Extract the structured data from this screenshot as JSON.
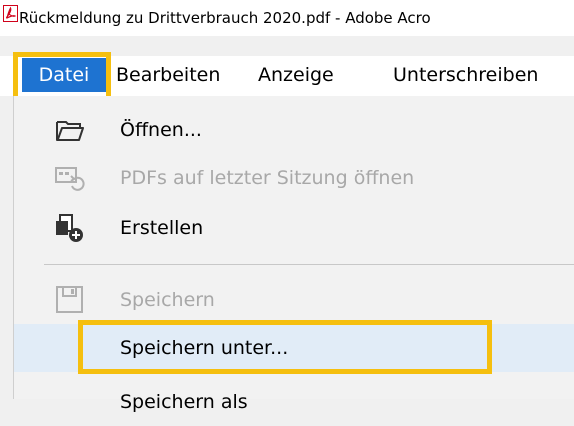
{
  "window": {
    "title": "Rückmeldung zu Drittverbrauch 2020.pdf - Adobe Acro",
    "app_icon": "pdf-icon"
  },
  "menubar": {
    "items": [
      {
        "label": "Datei",
        "active": true
      },
      {
        "label": "Bearbeiten"
      },
      {
        "label": "Anzeige"
      },
      {
        "label": "Unterschreiben"
      }
    ]
  },
  "file_menu": {
    "items": [
      {
        "label": "Öffnen...",
        "icon": "folder-open-icon",
        "enabled": true
      },
      {
        "label": "PDFs auf letzter Sitzung öffnen",
        "icon": "restore-session-icon",
        "enabled": false
      },
      {
        "label": "Erstellen",
        "icon": "create-pdf-icon",
        "enabled": true
      },
      {
        "label": "Speichern",
        "icon": "save-disk-icon",
        "enabled": false
      },
      {
        "label": "Speichern unter...",
        "icon": "",
        "enabled": true,
        "highlighted": true
      },
      {
        "label": "Speichern als",
        "icon": "",
        "enabled": true
      }
    ]
  },
  "colors": {
    "highlight_border": "#f5bf0f",
    "menu_active_bg": "#1e73d1",
    "disabled_text": "#a8a8a8"
  }
}
